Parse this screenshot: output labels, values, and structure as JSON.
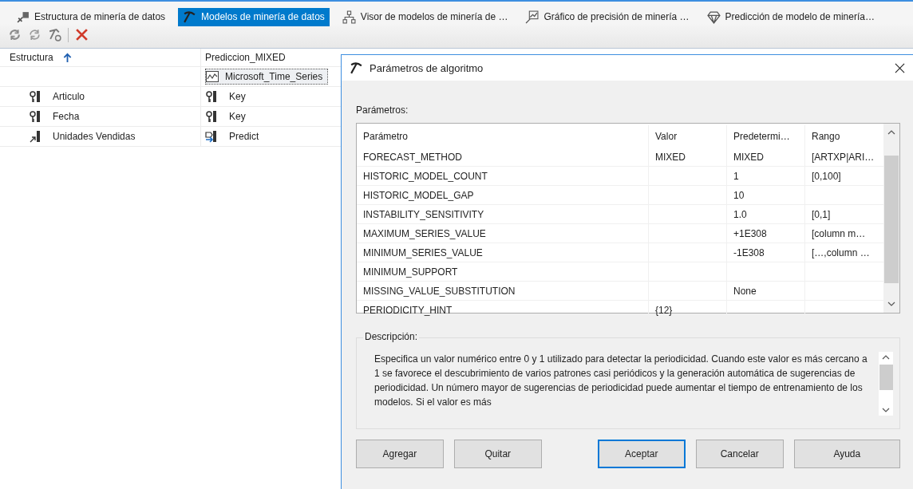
{
  "tabs": [
    {
      "label": "Estructura de minería de datos",
      "kind": "structure",
      "selected": false
    },
    {
      "label": "Modelos de minería de datos",
      "kind": "models",
      "selected": true
    },
    {
      "label": "Visor de modelos de minería de …",
      "kind": "viewer",
      "selected": false
    },
    {
      "label": "Gráfico de precisión de minería …",
      "kind": "accuracy",
      "selected": false
    },
    {
      "label": "Predicción de modelo de minería…",
      "kind": "prediction",
      "selected": false
    }
  ],
  "grid": {
    "columns": [
      "Estructura",
      "Prediccion_MIXED"
    ],
    "algorithm": "Microsoft_Time_Series",
    "rows": [
      {
        "name": "Articulo",
        "kind": "key",
        "usage": "Key"
      },
      {
        "name": "Fecha",
        "kind": "key",
        "usage": "Key"
      },
      {
        "name": "Unidades Vendidas",
        "kind": "predict",
        "usage": "Predict"
      }
    ]
  },
  "dialog": {
    "title": "Parámetros de algoritmo",
    "section_label": "Parámetros:",
    "table": {
      "columns": [
        "Parámetro",
        "Valor",
        "Predetermi…",
        "Rango"
      ],
      "rows": [
        [
          "FORECAST_METHOD",
          "MIXED",
          "MIXED",
          "[ARTXP|ARI…"
        ],
        [
          "HISTORIC_MODEL_COUNT",
          "",
          "1",
          "[0,100]"
        ],
        [
          "HISTORIC_MODEL_GAP",
          "",
          "10",
          ""
        ],
        [
          "INSTABILITY_SENSITIVITY",
          "",
          "1.0",
          "[0,1]"
        ],
        [
          "MAXIMUM_SERIES_VALUE",
          "",
          "+1E308",
          "[column m…"
        ],
        [
          "MINIMUM_SERIES_VALUE",
          "",
          "-1E308",
          "[…,column …"
        ],
        [
          "MINIMUM_SUPPORT",
          "",
          "",
          ""
        ],
        [
          "MISSING_VALUE_SUBSTITUTION",
          "",
          "None",
          ""
        ],
        [
          "PERIODICITY_HINT",
          "{12}",
          "",
          ""
        ]
      ]
    },
    "description_label": "Descripción:",
    "description": "Especifica un valor numérico entre 0 y 1 utilizado para detectar la periodicidad. Cuando este valor es más cercano a 1 se favorece el descubrimiento de varios patrones casi periódicos y la generación automática de sugerencias de periodicidad. Un número mayor de sugerencias de periodicidad puede aumentar el tiempo de entrenamiento de los modelos. Si el valor es más",
    "buttons": [
      {
        "label": "Agregar",
        "default": false
      },
      {
        "label": "Quitar",
        "default": false
      },
      {
        "label": "Aceptar",
        "default": true
      },
      {
        "label": "Cancelar",
        "default": false
      },
      {
        "label": "Ayuda",
        "default": false
      }
    ]
  }
}
